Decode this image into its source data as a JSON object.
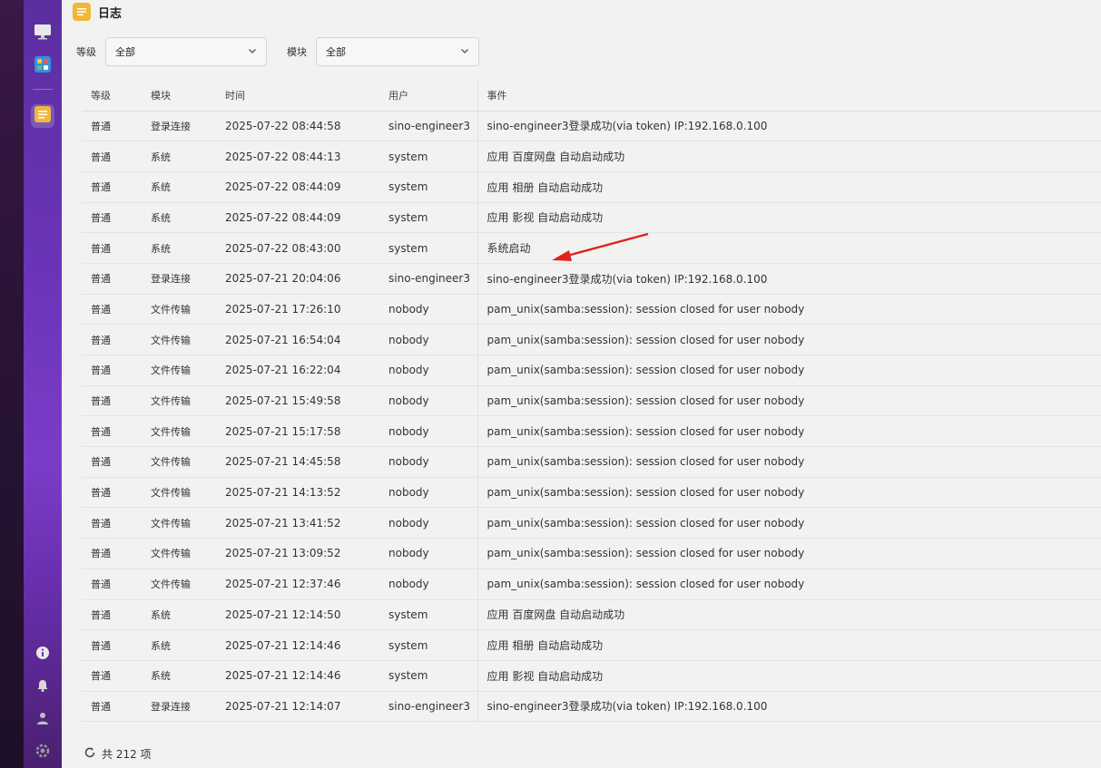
{
  "window": {
    "title": "日志"
  },
  "filters": {
    "level_label": "等级",
    "level_value": "全部",
    "module_label": "模块",
    "module_value": "全部"
  },
  "table": {
    "columns": [
      "等级",
      "模块",
      "时间",
      "用户",
      "事件"
    ],
    "rows": [
      [
        "普通",
        "登录连接",
        "2025-07-22 08:44:58",
        "sino-engineer3",
        "sino-engineer3登录成功(via token) IP:192.168.0.100"
      ],
      [
        "普通",
        "系统",
        "2025-07-22 08:44:13",
        "system",
        "应用 百度网盘 自动启动成功"
      ],
      [
        "普通",
        "系统",
        "2025-07-22 08:44:09",
        "system",
        "应用 相册 自动启动成功"
      ],
      [
        "普通",
        "系统",
        "2025-07-22 08:44:09",
        "system",
        "应用 影视 自动启动成功"
      ],
      [
        "普通",
        "系统",
        "2025-07-22 08:43:00",
        "system",
        "系统启动"
      ],
      [
        "普通",
        "登录连接",
        "2025-07-21 20:04:06",
        "sino-engineer3",
        "sino-engineer3登录成功(via token) IP:192.168.0.100"
      ],
      [
        "普通",
        "文件传输",
        "2025-07-21 17:26:10",
        "nobody",
        "pam_unix(samba:session): session closed for user nobody"
      ],
      [
        "普通",
        "文件传输",
        "2025-07-21 16:54:04",
        "nobody",
        "pam_unix(samba:session): session closed for user nobody"
      ],
      [
        "普通",
        "文件传输",
        "2025-07-21 16:22:04",
        "nobody",
        "pam_unix(samba:session): session closed for user nobody"
      ],
      [
        "普通",
        "文件传输",
        "2025-07-21 15:49:58",
        "nobody",
        "pam_unix(samba:session): session closed for user nobody"
      ],
      [
        "普通",
        "文件传输",
        "2025-07-21 15:17:58",
        "nobody",
        "pam_unix(samba:session): session closed for user nobody"
      ],
      [
        "普通",
        "文件传输",
        "2025-07-21 14:45:58",
        "nobody",
        "pam_unix(samba:session): session closed for user nobody"
      ],
      [
        "普通",
        "文件传输",
        "2025-07-21 14:13:52",
        "nobody",
        "pam_unix(samba:session): session closed for user nobody"
      ],
      [
        "普通",
        "文件传输",
        "2025-07-21 13:41:52",
        "nobody",
        "pam_unix(samba:session): session closed for user nobody"
      ],
      [
        "普通",
        "文件传输",
        "2025-07-21 13:09:52",
        "nobody",
        "pam_unix(samba:session): session closed for user nobody"
      ],
      [
        "普通",
        "文件传输",
        "2025-07-21 12:37:46",
        "nobody",
        "pam_unix(samba:session): session closed for user nobody"
      ],
      [
        "普通",
        "系统",
        "2025-07-21 12:14:50",
        "system",
        "应用 百度网盘 自动启动成功"
      ],
      [
        "普通",
        "系统",
        "2025-07-21 12:14:46",
        "system",
        "应用 相册 自动启动成功"
      ],
      [
        "普通",
        "系统",
        "2025-07-21 12:14:46",
        "system",
        "应用 影视 自动启动成功"
      ],
      [
        "普通",
        "登录连接",
        "2025-07-21 12:14:07",
        "sino-engineer3",
        "sino-engineer3登录成功(via token) IP:192.168.0.100"
      ]
    ]
  },
  "footer": {
    "total_text": "共 212 项"
  },
  "icons": {
    "title": "log-icon",
    "sidebar": [
      "monitor-icon",
      "app-grid-icon",
      "log-icon"
    ],
    "sidebar_bottom": [
      "info-icon",
      "bell-icon",
      "user-icon",
      "settings-icon"
    ],
    "refresh": "refresh-icon",
    "annotation": "red-arrow-annotation"
  },
  "colors": {
    "sidebar": "#6a34b8",
    "title_icon": "#f0b73a",
    "annotation_arrow": "#e0221e"
  }
}
